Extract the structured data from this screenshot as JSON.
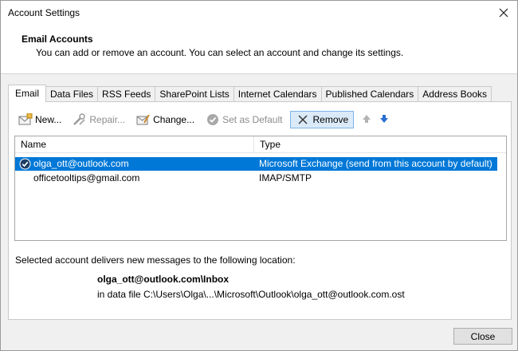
{
  "window": {
    "title": "Account Settings",
    "close_icon": "close-icon"
  },
  "header": {
    "title": "Email Accounts",
    "description": "You can add or remove an account. You can select an account and change its settings."
  },
  "tabs": [
    {
      "label": "Email",
      "active": true
    },
    {
      "label": "Data Files",
      "active": false
    },
    {
      "label": "RSS Feeds",
      "active": false
    },
    {
      "label": "SharePoint Lists",
      "active": false
    },
    {
      "label": "Internet Calendars",
      "active": false
    },
    {
      "label": "Published Calendars",
      "active": false
    },
    {
      "label": "Address Books",
      "active": false
    }
  ],
  "toolbar": {
    "new_label": "New...",
    "repair_label": "Repair...",
    "change_label": "Change...",
    "set_default_label": "Set as Default",
    "remove_label": "Remove"
  },
  "list": {
    "columns": {
      "name": "Name",
      "type": "Type"
    },
    "rows": [
      {
        "name": "olga_ott@outlook.com",
        "type": "Microsoft Exchange (send from this account by default)",
        "selected": true,
        "is_default": true
      },
      {
        "name": "officetooltips@gmail.com",
        "type": "IMAP/SMTP",
        "selected": false,
        "is_default": false
      }
    ]
  },
  "location": {
    "label": "Selected account delivers new messages to the following location:",
    "path": "olga_ott@outlook.com\\Inbox",
    "file": "in data file C:\\Users\\Olga\\...\\Microsoft\\Outlook\\olga_ott@outlook.com.ost"
  },
  "footer": {
    "close_label": "Close"
  },
  "colors": {
    "selection": "#0078d7",
    "accent_arrow": "#2a6ed1"
  }
}
